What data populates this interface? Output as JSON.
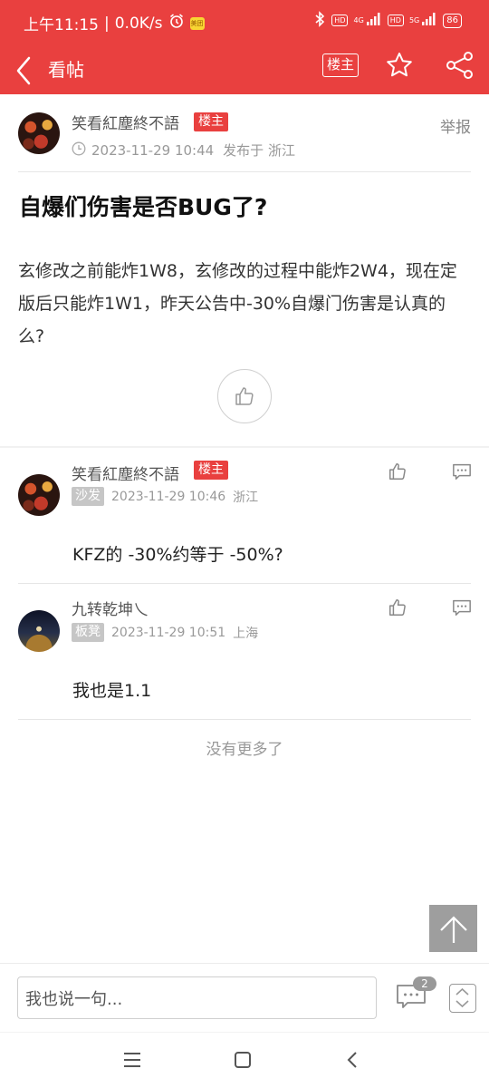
{
  "status_bar": {
    "time": "上午11:15",
    "network_speed": "0.0K/s",
    "app_badge": "美团",
    "hd1": "HD",
    "signal1": "4G",
    "hd2": "HD",
    "signal2": "5G",
    "battery": "86"
  },
  "nav": {
    "title": "看帖",
    "owner_button": "楼主"
  },
  "post": {
    "author": "笑看紅塵終不語",
    "owner_tag": "楼主",
    "report": "举报",
    "time": "2023-11-29 10:44",
    "location": "发布于 浙江",
    "title": "自爆们伤害是否BUG了?",
    "body": "玄修改之前能炸1W8，玄修改的过程中能炸2W4，现在定版后只能炸1W1，昨天公告中-30%自爆门伤害是认真的么?"
  },
  "replies": [
    {
      "author": "笑看紅塵終不語",
      "owner_tag": "楼主",
      "floor": "沙发",
      "time": "2023-11-29 10:46",
      "location": "浙江",
      "content": "KFZ的 -30%约等于 -50%?"
    },
    {
      "author": "九转乾坤乀",
      "floor": "板凳",
      "time": "2023-11-29 10:51",
      "location": "上海",
      "content": "我也是1.1"
    }
  ],
  "no_more": "没有更多了",
  "bottom_bar": {
    "input_placeholder": "我也说一句...",
    "comment_count": "2"
  },
  "colors": {
    "brand": "#e9403f",
    "floor_tag": "#c6c6c6"
  }
}
